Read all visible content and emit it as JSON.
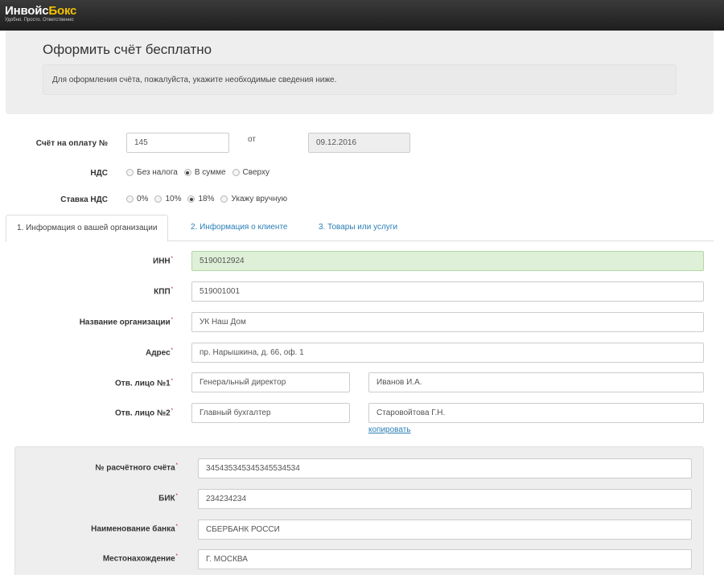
{
  "brand": {
    "name_part1": "Инвойс",
    "name_part2": "Бокс",
    "tagline": "Удобно. Просто. Ответственно"
  },
  "header": {
    "title": "Оформить счёт бесплатно",
    "info": "Для оформления счёта, пожалуйста, укажите необходимые сведения ниже."
  },
  "invoice": {
    "number_label": "Счёт на оплату №",
    "number_value": "145",
    "from_label": "от",
    "date_value": "09.12.2016"
  },
  "nds": {
    "label": "НДС",
    "options": [
      {
        "label": "Без налога",
        "checked": false
      },
      {
        "label": "В сумме",
        "checked": true
      },
      {
        "label": "Сверху",
        "checked": false
      }
    ]
  },
  "rate": {
    "label": "Ставка НДС",
    "options": [
      {
        "label": "0%",
        "checked": false
      },
      {
        "label": "10%",
        "checked": false
      },
      {
        "label": "18%",
        "checked": true
      },
      {
        "label": "Укажу вручную",
        "checked": false
      }
    ]
  },
  "tabs": [
    {
      "label": "1. Информация о вашей организации",
      "active": true
    },
    {
      "label": "2. Информация о клиенте",
      "active": false
    },
    {
      "label": "3. Товары или услуги",
      "active": false
    }
  ],
  "org": {
    "inn_label": "ИНН",
    "inn_value": "5190012924",
    "kpp_label": "КПП",
    "kpp_value": "519001001",
    "name_label": "Название организации",
    "name_value": "УК Наш Дом",
    "address_label": "Адрес",
    "address_value": "пр. Нарышкина, д. 66, оф. 1",
    "resp1_label": "Отв. лицо №1",
    "resp1_position": "Генеральный директор",
    "resp1_name": "Иванов И.А.",
    "resp2_label": "Отв. лицо №2",
    "resp2_position": "Главный бухгалтер",
    "resp2_name": "Старовойтова Г.Н.",
    "copy_link": "копировать",
    "required_mark": "*"
  },
  "bank": {
    "account_label": "№ расчётного счёта",
    "account_value": "345435345345345534534",
    "bik_label": "БИК",
    "bik_value": "234234234",
    "bank_name_label": "Наименование банка",
    "bank_name_value": "СБЕРБАНК РОССИ",
    "location_label": "Местонахождение",
    "location_value": "Г. МОСКВА"
  },
  "colors": {
    "accent": "#f7c200",
    "link": "#2a7fb6",
    "valid_bg": "#dff0d8"
  }
}
